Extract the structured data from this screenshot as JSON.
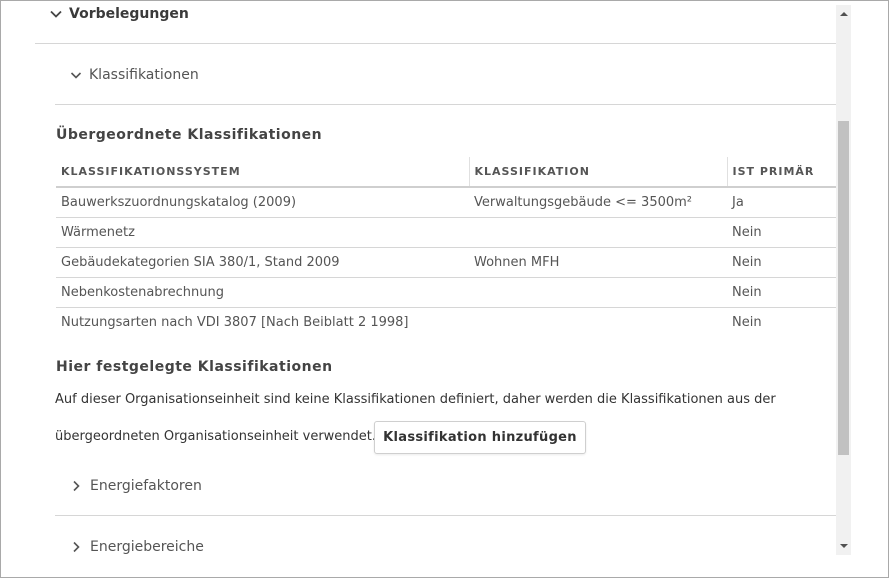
{
  "sections": {
    "vorbelegungen": "Vorbelegungen",
    "klassifikationen": "Klassifikationen",
    "energiefaktoren": "Energiefaktoren",
    "energiebereiche": "Energiebereiche"
  },
  "parent_classifications": {
    "heading": "Übergeordnete Klassifikationen",
    "columns": [
      "KLASSIFIKATIONSSYSTEM",
      "KLASSIFIKATION",
      "IST PRIMÄR"
    ],
    "rows": [
      [
        "Bauwerkszuordnungskatalog (2009)",
        "Verwaltungsgebäude <= 3500m²",
        "Ja"
      ],
      [
        "Wärmenetz",
        "",
        "Nein"
      ],
      [
        "Gebäudekategorien SIA 380/1, Stand 2009",
        "Wohnen MFH",
        "Nein"
      ],
      [
        "Nebenkostenabrechnung",
        "",
        "Nein"
      ],
      [
        "Nutzungsarten nach VDI 3807 [Nach Beiblatt 2 1998]",
        "",
        "Nein"
      ]
    ]
  },
  "local_classifications": {
    "heading": "Hier festgelegte Klassifikationen",
    "info_line1": "Auf dieser Organisationseinheit sind keine Klassifikationen definiert, daher werden die Klassifikationen aus der",
    "info_line2": "übergeordneten Organisationseinheit verwendet.",
    "add_button": "Klassifikation hinzufügen"
  },
  "icons": {
    "expanded": "chevron-down-icon",
    "collapsed": "chevron-right-icon",
    "scroll_up": "scroll-up-arrow-icon",
    "scroll_down": "scroll-down-arrow-icon"
  }
}
